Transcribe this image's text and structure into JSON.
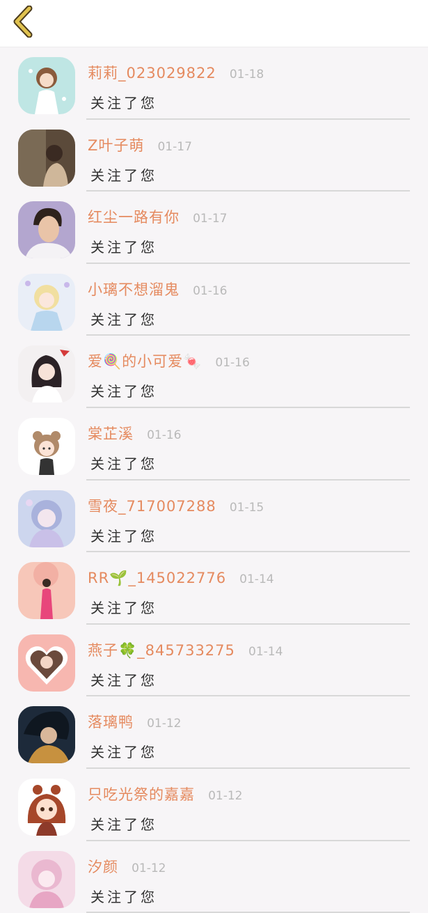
{
  "header": {
    "back_icon": "chevron-left-icon",
    "back_color": "#e0c24f"
  },
  "colors": {
    "name": "#e58a5f",
    "date": "#b9b9b9",
    "action": "#333333",
    "background": "#f7f5f7"
  },
  "notifications": [
    {
      "name": "莉莉_023029822",
      "date": "01-18",
      "action": "关注了您",
      "avatar": "anime-girl-avatar"
    },
    {
      "name": "Z叶子萌",
      "date": "01-17",
      "action": "关注了您",
      "avatar": "photo-avatar"
    },
    {
      "name": "红尘一路有你",
      "date": "01-17",
      "action": "关注了您",
      "avatar": "man-portrait-avatar"
    },
    {
      "name": "小璃不想溜鬼",
      "date": "01-16",
      "action": "关注了您",
      "avatar": "anime-girl-avatar"
    },
    {
      "name": "爱🍭的小可爱🍬",
      "date": "01-16",
      "action": "关注了您",
      "avatar": "anime-girl-avatar"
    },
    {
      "name": "棠芷溪",
      "date": "01-16",
      "action": "关注了您",
      "avatar": "cartoon-bear-avatar"
    },
    {
      "name": "雪夜_717007288",
      "date": "01-15",
      "action": "关注了您",
      "avatar": "anime-girl-avatar"
    },
    {
      "name": "RR🌱_145022776",
      "date": "01-14",
      "action": "关注了您",
      "avatar": "photo-avatar"
    },
    {
      "name": "燕子🍀_845733275",
      "date": "01-14",
      "action": "关注了您",
      "avatar": "heart-frame-avatar"
    },
    {
      "name": "落璃鸭",
      "date": "01-12",
      "action": "关注了您",
      "avatar": "anime-character-avatar"
    },
    {
      "name": "只吃光祭的嘉嘉",
      "date": "01-12",
      "action": "关注了您",
      "avatar": "cartoon-girl-avatar"
    },
    {
      "name": "汐颜",
      "date": "01-12",
      "action": "关注了您",
      "avatar": "anime-girl-avatar"
    }
  ]
}
